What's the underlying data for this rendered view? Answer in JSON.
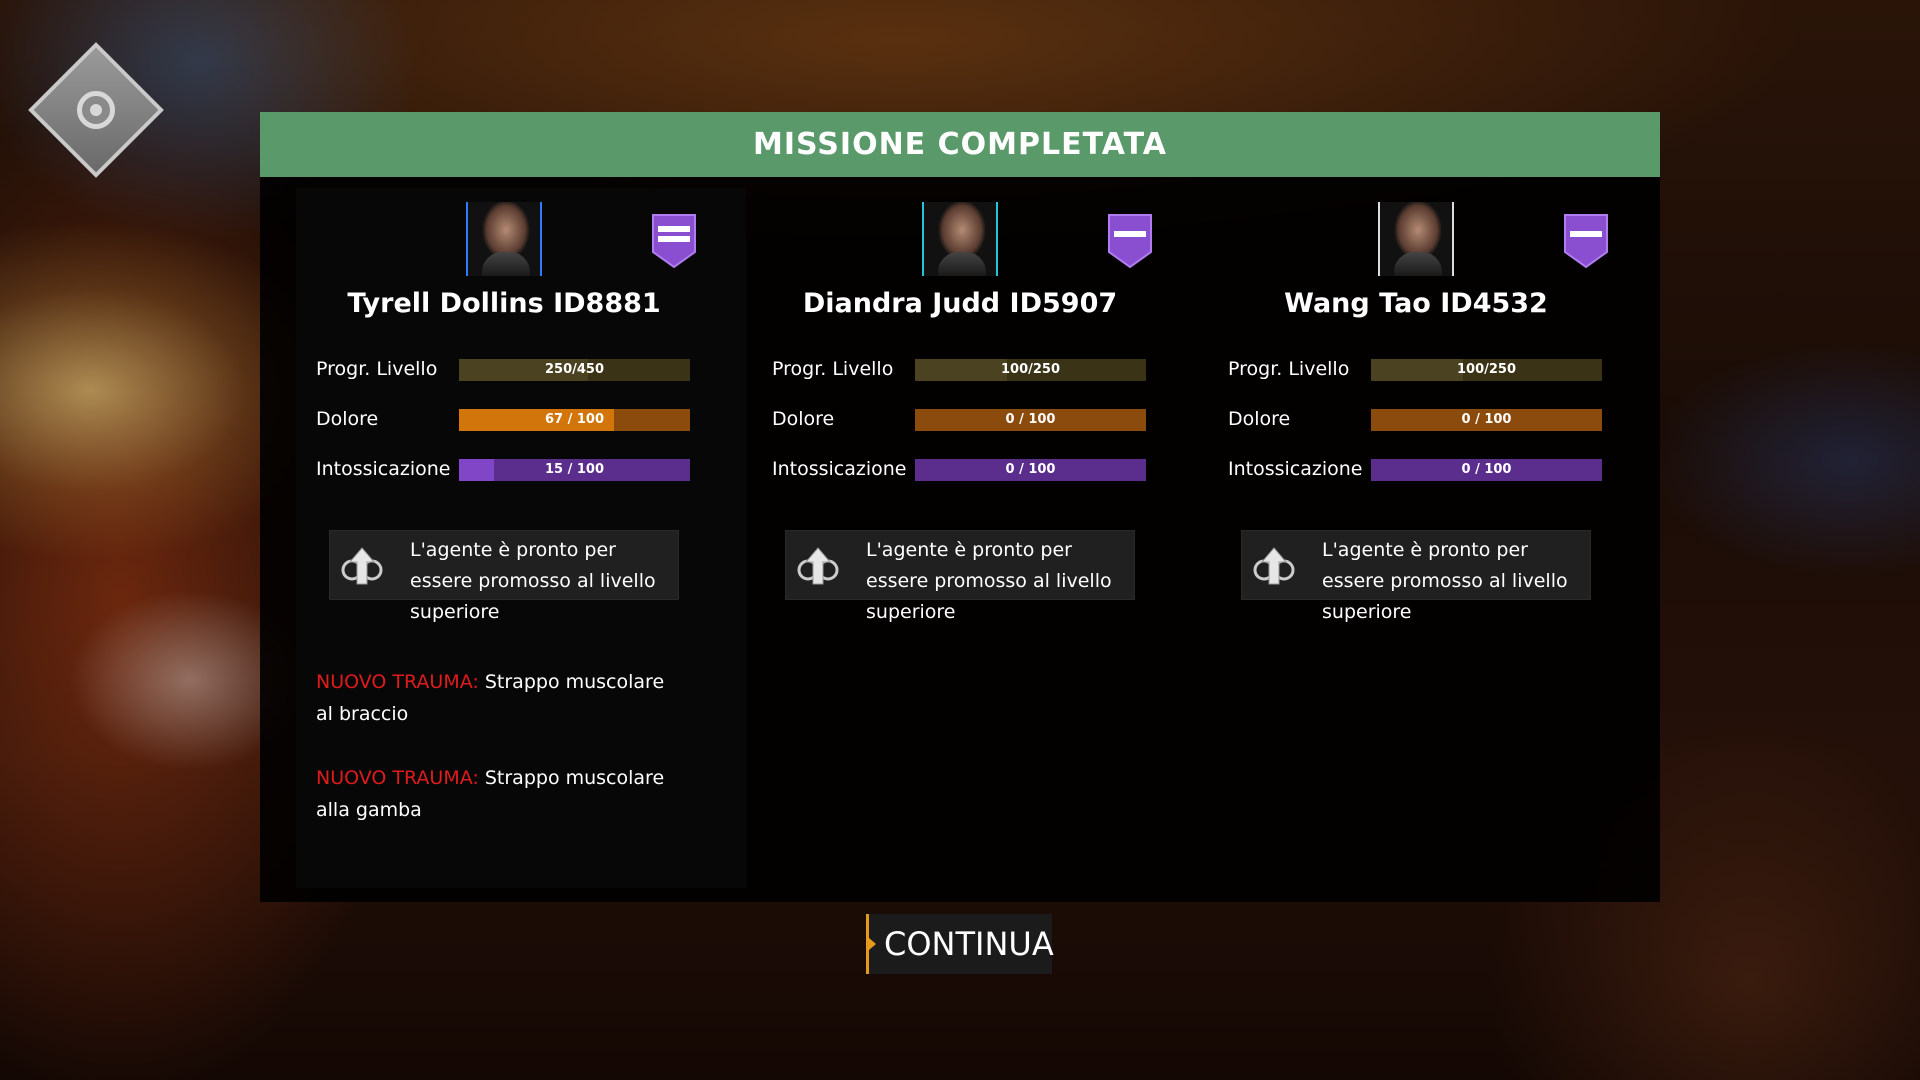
{
  "header": {
    "title": "MISSIONE COMPLETATA"
  },
  "colors": {
    "header_bg": "#5a9a6a",
    "level_bar": "#3a3316",
    "pain_bar": "#d2760c",
    "tox_bar": "#8145c7",
    "trauma_label": "#e01b1b",
    "continue_accent": "#e69a1c"
  },
  "agents": [
    {
      "name": "Tyrell Dollins ID8881",
      "stats": {
        "level": {
          "label": "Progr. Livello",
          "text": "250/450",
          "fraction": 0.56
        },
        "pain": {
          "label": "Dolore",
          "text": "67 / 100",
          "fraction": 0.67
        },
        "tox": {
          "label": "Intossicazione",
          "text": "15 / 100",
          "fraction": 0.15
        }
      },
      "promotion": "L'agente è pronto per essere promosso al livello superiore",
      "traumas": [
        {
          "label": "NUOVO TRAUMA:",
          "text": " Strappo muscolare al braccio"
        },
        {
          "label": "NUOVO TRAUMA:",
          "text": " Strappo muscolare alla gamba"
        }
      ]
    },
    {
      "name": "Diandra Judd ID5907",
      "stats": {
        "level": {
          "label": "Progr. Livello",
          "text": "100/250",
          "fraction": 0.4
        },
        "pain": {
          "label": "Dolore",
          "text": "0 / 100",
          "fraction": 0
        },
        "tox": {
          "label": "Intossicazione",
          "text": "0 / 100",
          "fraction": 0
        }
      },
      "promotion": "L'agente è pronto per essere promosso al livello superiore"
    },
    {
      "name": "Wang Tao ID4532",
      "stats": {
        "level": {
          "label": "Progr. Livello",
          "text": "100/250",
          "fraction": 0.4
        },
        "pain": {
          "label": "Dolore",
          "text": "0 / 100",
          "fraction": 0
        },
        "tox": {
          "label": "Intossicazione",
          "text": "0 / 100",
          "fraction": 0
        }
      },
      "promotion": "L'agente è pronto per essere promosso al livello superiore"
    }
  ],
  "continue": {
    "label": "CONTINUA"
  },
  "icons": {
    "logo": "target-emblem-icon",
    "rank": "rank-badge-icon",
    "promotion": "upgrade-arrow-icon"
  }
}
